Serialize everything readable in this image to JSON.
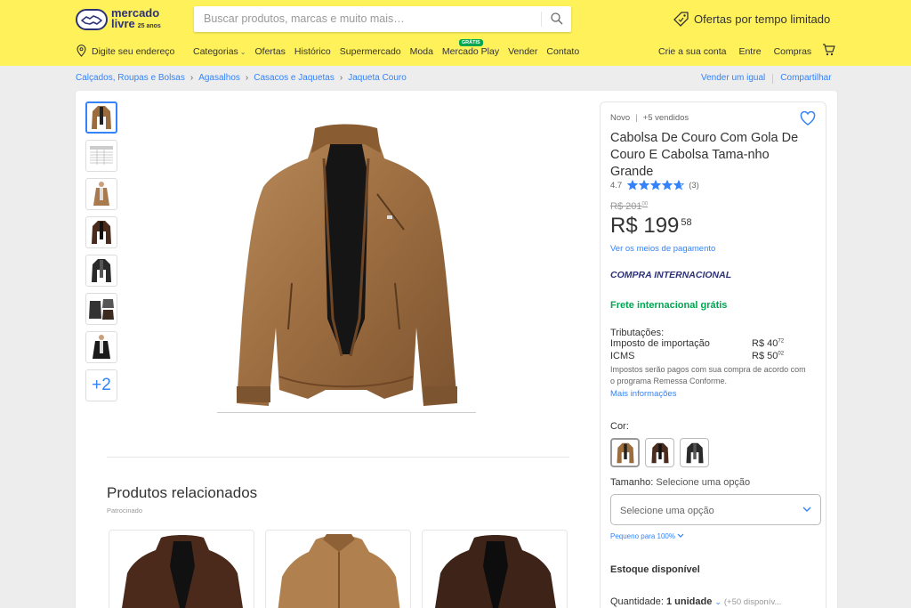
{
  "header": {
    "logo_line1": "mercado",
    "logo_line2": "livre",
    "logo_badge": "25 anos",
    "search_placeholder": "Buscar produtos, marcas e muito mais…",
    "promo": "Ofertas por tempo limitado",
    "address": "Digite seu endereço",
    "nav": [
      "Categorias",
      "Ofertas",
      "Histórico",
      "Supermercado",
      "Moda",
      "Mercado Play",
      "Vender",
      "Contato"
    ],
    "gratis_badge": "GRÁTIS",
    "user_links": [
      "Crie a sua conta",
      "Entre",
      "Compras"
    ],
    "brand_color": "#fff159"
  },
  "breadcrumbs": [
    "Calçados, Roupas e Bolsas",
    "Agasalhos",
    "Casacos e Jaquetas",
    "Jaqueta Couro"
  ],
  "crumb_actions": [
    "Vender um igual",
    "Compartilhar"
  ],
  "gallery": {
    "more_label": "+2"
  },
  "related": {
    "title": "Produtos relacionados",
    "subtitle": "Patrocinado"
  },
  "product": {
    "condition": "Novo",
    "sold": "+5 vendidos",
    "title": "Cabolsa De Couro Com Gola De Couro E Cabolsa Tama-nho Grande",
    "rating": "4.7",
    "rating_value": 4.7,
    "reviews": "(3)",
    "old_price": "R$ 201",
    "old_price_cents": "00",
    "price": "R$ 199",
    "price_cents": "58",
    "payment_link": "Ver os meios de pagamento",
    "international": "COMPRA INTERNACIONAL",
    "shipping": "Frete internacional grátis",
    "tributes_label": "Tributações:",
    "tributes": [
      {
        "name": "Imposto de importação",
        "value": "R$ 40",
        "cents": "72"
      },
      {
        "name": "ICMS",
        "value": "R$ 50",
        "cents": "02"
      }
    ],
    "tributes_note": "Impostos serão pagos com sua compra de acordo com o programa Remessa Conforme.",
    "tributes_more": "Mais informações",
    "color_label": "Cor:",
    "size_label": "Tamanho:",
    "size_hint": "Selecione uma opção",
    "size_select": "Selecione uma opção",
    "fit": "Pequeno para 100%",
    "stock": "Estoque disponível",
    "qty_label": "Quantidade:",
    "qty_value": "1 unidade",
    "qty_avail": "(+50 disponív..."
  },
  "colors": {
    "accent": "#3483fa",
    "green": "#00a650",
    "navy": "#2d3277"
  }
}
